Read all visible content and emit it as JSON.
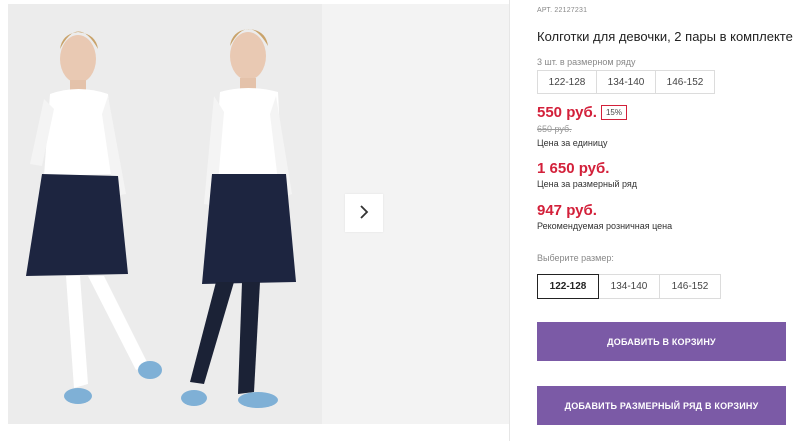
{
  "gallery": {
    "next_icon": "chevron-right-icon"
  },
  "product": {
    "article": "АРТ. 22127231",
    "title": "Колготки для девочки, 2 пары в комплекте",
    "set_label": "3 шт. в размерном ряду",
    "set_sizes": [
      "122-128",
      "134-140",
      "146-152"
    ],
    "price": "550 руб.",
    "discount": "15%",
    "old_price": "650 руб.",
    "unit_label": "Цена за единицу",
    "row_price": "1 650 руб.",
    "row_price_label": "Цена за размерный ряд",
    "rrp": "947 руб.",
    "rrp_label": "Рекомендуемая розничная цена",
    "choose_size_label": "Выберите размер:",
    "sizes": [
      {
        "label": "122-128",
        "selected": true
      },
      {
        "label": "134-140",
        "selected": false
      },
      {
        "label": "146-152",
        "selected": false
      }
    ],
    "add_to_cart": "ДОБАВИТЬ В КОРЗИНУ",
    "add_row_to_cart": "ДОБАВИТЬ РАЗМЕРНЫЙ РЯД В КОРЗИНУ"
  },
  "colors": {
    "accent": "#7b5aa6",
    "price_red": "#d3203a"
  }
}
